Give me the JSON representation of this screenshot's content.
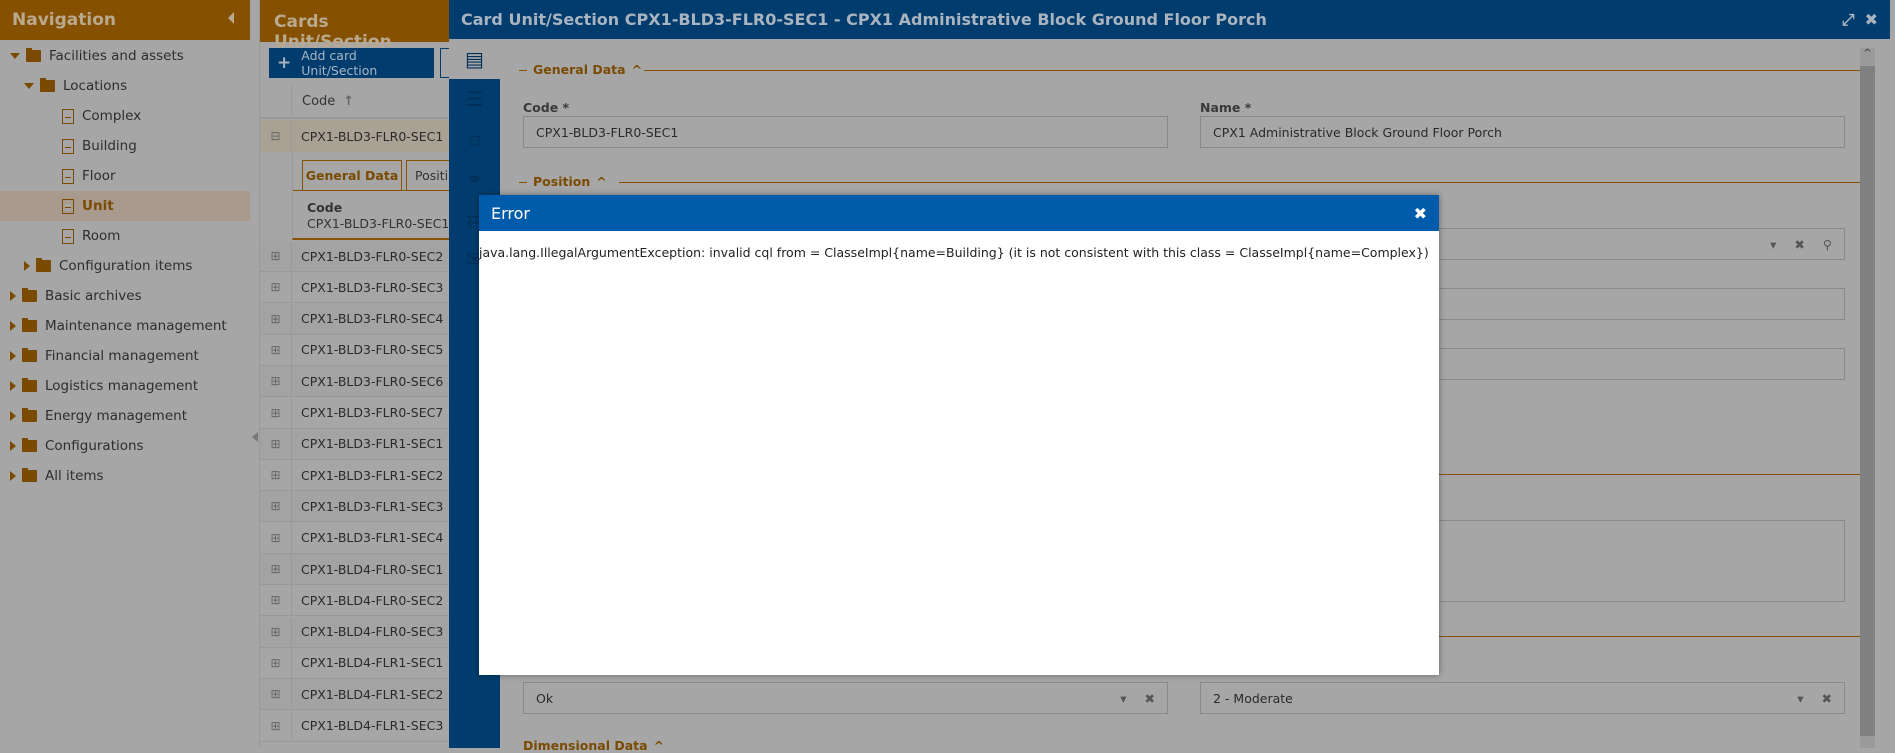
{
  "navigation": {
    "title": "Navigation",
    "items": [
      {
        "label": "Facilities and assets",
        "level": 0,
        "type": "folder",
        "state": "expanded"
      },
      {
        "label": "Locations",
        "level": 1,
        "type": "folder",
        "state": "expanded"
      },
      {
        "label": "Complex",
        "level": 2,
        "type": "class"
      },
      {
        "label": "Building",
        "level": 2,
        "type": "class"
      },
      {
        "label": "Floor",
        "level": 2,
        "type": "class"
      },
      {
        "label": "Unit",
        "level": 2,
        "type": "class",
        "selected": true
      },
      {
        "label": "Room",
        "level": 2,
        "type": "class"
      },
      {
        "label": "Configuration items",
        "level": 1,
        "type": "folder",
        "state": "collapsed"
      },
      {
        "label": "Basic archives",
        "level": 0,
        "type": "folder",
        "state": "collapsed"
      },
      {
        "label": "Maintenance management",
        "level": 0,
        "type": "folder",
        "state": "collapsed"
      },
      {
        "label": "Financial management",
        "level": 0,
        "type": "folder",
        "state": "collapsed"
      },
      {
        "label": "Logistics management",
        "level": 0,
        "type": "folder",
        "state": "collapsed"
      },
      {
        "label": "Energy management",
        "level": 0,
        "type": "folder",
        "state": "collapsed"
      },
      {
        "label": "Configurations",
        "level": 0,
        "type": "folder",
        "state": "collapsed"
      },
      {
        "label": "All items",
        "level": 0,
        "type": "folder",
        "state": "collapsed"
      }
    ]
  },
  "cards": {
    "title": "Cards Unit/Section",
    "add_button": "Add card Unit/Section",
    "column": "Code",
    "sort": "ascending",
    "expanded": {
      "code": "CPX1-BLD3-FLR0-SEC1",
      "tabs": [
        "General Data",
        "Positi"
      ],
      "field_label": "Code",
      "field_value": "CPX1-BLD3-FLR0-SEC1"
    },
    "rows": [
      "CPX1-BLD3-FLR0-SEC2",
      "CPX1-BLD3-FLR0-SEC3",
      "CPX1-BLD3-FLR0-SEC4",
      "CPX1-BLD3-FLR0-SEC5",
      "CPX1-BLD3-FLR0-SEC6",
      "CPX1-BLD3-FLR0-SEC7",
      "CPX1-BLD3-FLR1-SEC1",
      "CPX1-BLD3-FLR1-SEC2",
      "CPX1-BLD3-FLR1-SEC3",
      "CPX1-BLD3-FLR1-SEC4",
      "CPX1-BLD4-FLR0-SEC1",
      "CPX1-BLD4-FLR0-SEC2",
      "CPX1-BLD4-FLR0-SEC3",
      "CPX1-BLD4-FLR1-SEC1",
      "CPX1-BLD4-FLR1-SEC2",
      "CPX1-BLD4-FLR1-SEC3"
    ]
  },
  "card": {
    "title": "Card Unit/Section CPX1-BLD3-FLR0-SEC1 - CPX1 Administrative Block Ground Floor Porch",
    "sections": {
      "general": "General Data",
      "position": "Position",
      "dimensional": "Dimensional Data"
    },
    "code_label": "Code *",
    "code_value": "CPX1-BLD3-FLR0-SEC1",
    "name_label": "Name *",
    "name_value": "CPX1 Administrative Block Ground Floor Porch",
    "condition_value": "Ok",
    "criticality_value": "2 - Moderate"
  },
  "error": {
    "title": "Error",
    "message": "java.lang.IllegalArgumentException: invalid cql from = ClasseImpl{name=Building} (it is not consistent with this class = ClasseImpl{name=Complex})"
  },
  "colors": {
    "nav_header": "#855000",
    "card_header": "#003d6e",
    "error_header": "#005baa",
    "accent": "#8a5200"
  }
}
